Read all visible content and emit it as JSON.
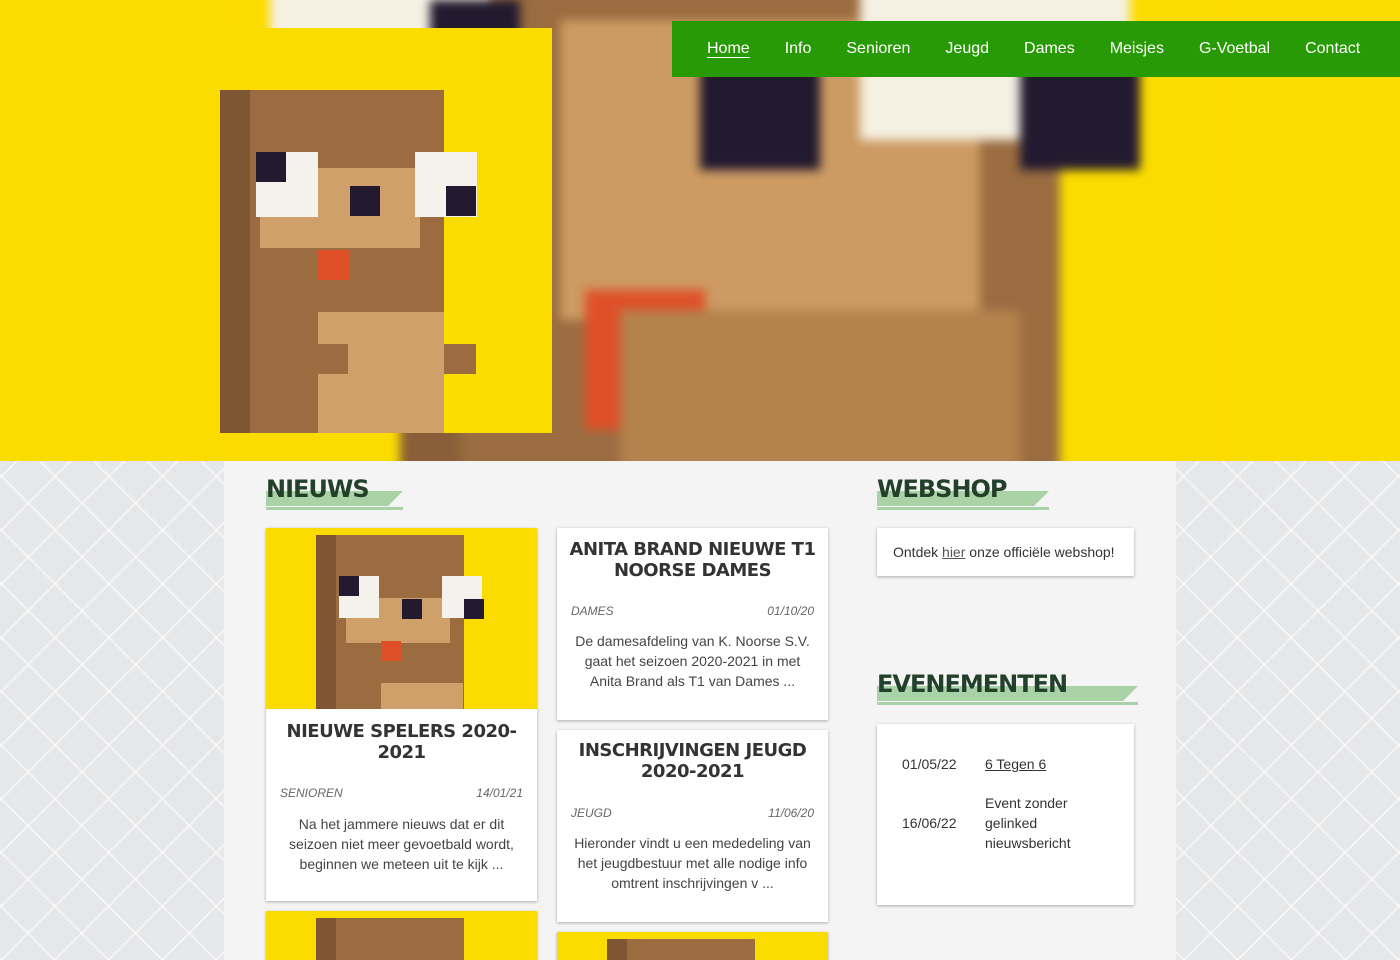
{
  "colors": {
    "brand_yellow": "#fbdc00",
    "nav_green": "#289a05",
    "title_green": "#23402a",
    "accent_band": "#a9d2a6"
  },
  "nav": {
    "items": [
      {
        "label": "Home",
        "active": true
      },
      {
        "label": "Info"
      },
      {
        "label": "Senioren"
      },
      {
        "label": "Jeugd"
      },
      {
        "label": "Dames"
      },
      {
        "label": "Meisjes"
      },
      {
        "label": "G-Voetbal"
      },
      {
        "label": "Contact"
      }
    ]
  },
  "news": {
    "title": "NIEUWS",
    "posts": [
      {
        "title": "NIEUWE SPELERS 2020-2021",
        "category": "SENIOREN",
        "date": "14/01/21",
        "excerpt": "Na het jammere nieuws dat er dit seizoen niet meer gevoetbald wordt, beginnen we meteen uit te kijk ..."
      },
      {
        "title": "ANITA BRAND NIEUWE T1 NOORSE DAMES",
        "category": "DAMES",
        "date": "01/10/20",
        "excerpt": "De damesafdeling van K. Noorse S.V. gaat het seizoen 2020-2021 in met Anita Brand als T1 van Dames ..."
      },
      {
        "title": "INSCHRIJVINGEN JEUGD 2020-2021",
        "category": "JEUGD",
        "date": "11/06/20",
        "excerpt": "Hieronder vindt u een mededeling van het jeugdbestuur met alle nodige info omtrent inschrijvingen v ..."
      }
    ]
  },
  "webshop": {
    "title": "WEBSHOP",
    "text_before": "Ontdek ",
    "link": "hier",
    "text_after": " onze officiële webshop!"
  },
  "events": {
    "title": "EVENEMENTEN",
    "items": [
      {
        "date": "01/05/22",
        "name": "6 Tegen 6",
        "linked": true
      },
      {
        "date": "16/06/22",
        "name": "Event zonder gelinked nieuwsbericht",
        "linked": false
      }
    ]
  }
}
